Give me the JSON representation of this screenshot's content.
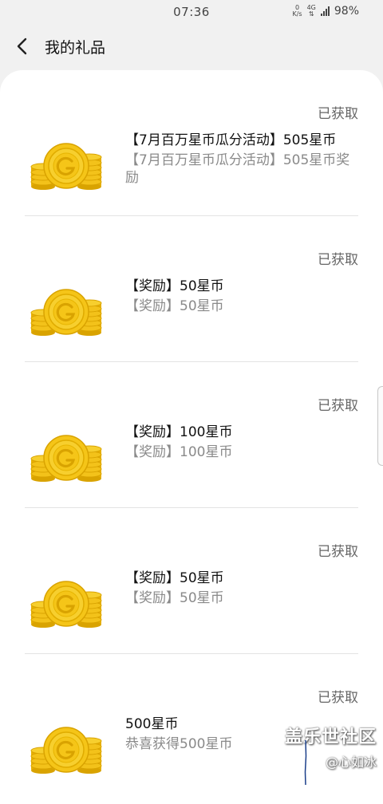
{
  "status_bar": {
    "time": "07:36",
    "net_speed_value": "0",
    "net_speed_unit": "K/s",
    "network_type": "4G",
    "battery": "98%"
  },
  "header": {
    "back_icon": "chevron-left-icon",
    "title": "我的礼品"
  },
  "gifts": [
    {
      "status": "已获取",
      "title": "【7月百万星币瓜分活动】505星币",
      "desc": "【7月百万星币瓜分活动】505星币奖励",
      "icon": "gold-coin-icon"
    },
    {
      "status": "已获取",
      "title": "【奖励】50星币",
      "desc": "【奖励】50星币",
      "icon": "gold-coin-icon"
    },
    {
      "status": "已获取",
      "title": "【奖励】100星币",
      "desc": "【奖励】100星币",
      "icon": "gold-coin-icon"
    },
    {
      "status": "已获取",
      "title": "【奖励】50星币",
      "desc": "【奖励】50星币",
      "icon": "gold-coin-icon"
    },
    {
      "status": "已获取",
      "title": "500星币",
      "desc": "恭喜获得500星币",
      "icon": "gold-coin-icon"
    }
  ],
  "watermark": {
    "brand": "盖乐世社区",
    "user": "@心如冰"
  },
  "colors": {
    "background": "#f1f1f1",
    "card": "#ffffff",
    "coin_gold": "#f5c518",
    "coin_dark": "#d9a300",
    "status_text": "#666666",
    "desc_text": "#8a8a8a"
  }
}
